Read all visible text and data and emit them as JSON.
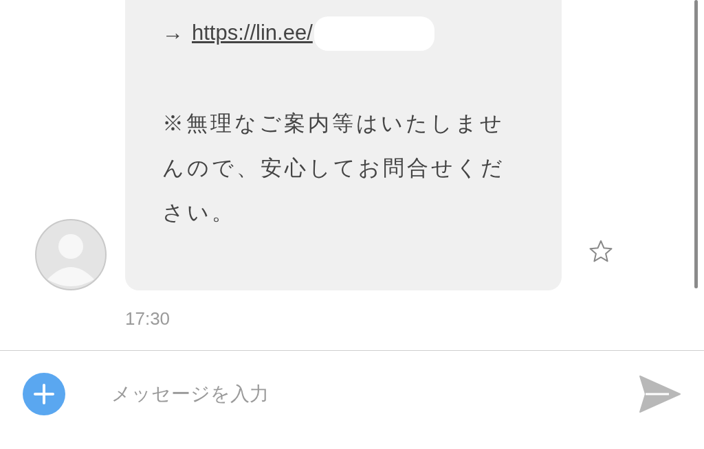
{
  "messages": [
    {
      "arrow": "→",
      "link": "https://lin.ee/",
      "body": "※無理なご案内等はいたしませんので、安心してお問合せください。",
      "time": "17:30",
      "starred": false
    }
  ],
  "composer": {
    "placeholder": "メッセージを入力"
  }
}
